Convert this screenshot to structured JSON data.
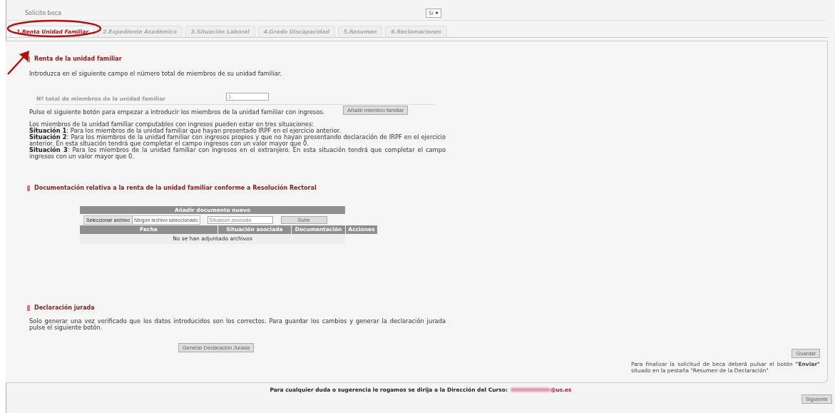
{
  "beca": {
    "label": "Solicito beca",
    "value": "Sí",
    "arrow": "▼"
  },
  "tabs": [
    {
      "label": "1.Renta Unidad Familiar",
      "selected": true
    },
    {
      "label": "2.Expediente Académico",
      "selected": false
    },
    {
      "label": "3.Situación Laboral",
      "selected": false
    },
    {
      "label": "4.Grado Discapacidad",
      "selected": false
    },
    {
      "label": "5.Resumen",
      "selected": false
    },
    {
      "label": "6.Reclamaciones",
      "selected": false
    }
  ],
  "renta": {
    "title": "Renta de la unidad familiar",
    "intro": "Introduzca en el siguiente campo el número total de miembros de su unidad familiar.",
    "member_count": {
      "label": "Nº total de miembros de la unidad familiar",
      "value": "1"
    },
    "add_prompt": "Pulse el siguiente botón para empezar a introducir los miembros de la unidad familiar con ingresos.",
    "add_button": "Añadir miembro familiar",
    "situations_intro": "Los miembros de la unidad familiar computables con ingresos pueden estar en tres situaciones:",
    "situations": [
      "**Situación 1**: Para los miembros de la unidad familiar que hayan presentado IRPF en el ejercicio anterior.",
      "**Situación 2**: Para los miembros de la unidad familiar con ingresos propios y que no hayan presentando declaración de IRPF en el ejercicio anterior. En esta situación tendrá que completar el campo ingresos con un valor mayor que 0.",
      "**Situación 3**: Para los miembros de la unidad familiar con ingresos en el extranjero. En esta situación tendrá que completar el campo ingresos con un valor mayor que 0."
    ]
  },
  "documentation": {
    "title": "Documentación relativa a la renta de la unidad familiar conforme a Resolución Rectoral",
    "upload": {
      "title": "Añadir documento nuevo",
      "file_button": "Seleccionar archivo",
      "file_status": "Ningún archivo seleccionado",
      "situation_placeholder": "Situación asociada",
      "submit_button": "Subir"
    },
    "columns": [
      "Fecha",
      "Situación asociada",
      "Documentación",
      "Acciones"
    ],
    "empty_message": "No se han adjuntado archivos"
  },
  "declaration": {
    "title": "Declaración jurada",
    "text": "Solo generar una vez verificado que los datos introducidos son los correctos. Para guardar los cambios y generar la declaración jurada pulse el siguiente botón.",
    "button": "Generar Declaración Jurada"
  },
  "save": {
    "button": "Guardar",
    "note": "Para finalizar la solicitud de beca deberá pulsar el botón **\"Enviar\"** situado en la pestaña \"Resumen de la Declaración\""
  },
  "footer": {
    "text": "Para cualquier duda o sugerencia le rogamos se dirija a la Dirección del Curso:",
    "email": "@us.es"
  },
  "next_button": "Siguiente"
}
